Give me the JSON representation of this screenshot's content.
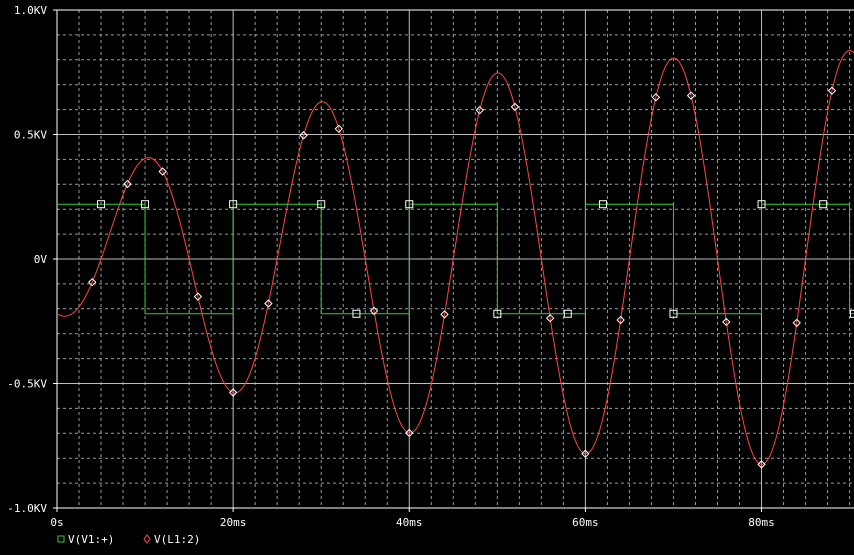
{
  "chart_data": {
    "type": "line",
    "x_unit": "s",
    "xlim": [
      0,
      0.0905
    ],
    "ylim": [
      -1000,
      1000
    ],
    "x_ticks": [
      0,
      0.02,
      0.04,
      0.06,
      0.08
    ],
    "x_tick_labels": [
      "0s",
      "20ms",
      "40ms",
      "60ms",
      "80ms"
    ],
    "y_ticks": [
      1000,
      500,
      0,
      -500,
      -1000
    ],
    "y_tick_labels": [
      "1.0KV",
      "0.5KV",
      "0V",
      "-0.5KV",
      "-1.0KV"
    ],
    "grid": true,
    "legend_position": "bottom-left",
    "series": [
      {
        "name": "V(V1:+)",
        "kind": "square",
        "color": "#33cc33",
        "marker": "square",
        "high": 220,
        "low": -220,
        "period": 0.02,
        "duty": 0.5,
        "marker_x": [
          0.005,
          0.01,
          0.02,
          0.03,
          0.034,
          0.04,
          0.05,
          0.058,
          0.062,
          0.07,
          0.08,
          0.087,
          0.0905
        ]
      },
      {
        "name": "V(L1:2)",
        "kind": "ringing-sine",
        "color": "#ff4444",
        "marker": "diamond",
        "omega": 314.159,
        "amplitude_start": 220,
        "amplitude_growth": 650,
        "growth_tau": 0.03,
        "offset_decay_tau": 0.02,
        "markers_every": 0.004,
        "peaks": [
          {
            "x": 0.0103,
            "y": 480
          },
          {
            "x": 0.0201,
            "y": -650
          },
          {
            "x": 0.0302,
            "y": 745
          },
          {
            "x": 0.0401,
            "y": -805
          },
          {
            "x": 0.0502,
            "y": 840
          },
          {
            "x": 0.0601,
            "y": -860
          },
          {
            "x": 0.0702,
            "y": 870
          },
          {
            "x": 0.0801,
            "y": -880
          },
          {
            "x": 0.0902,
            "y": 880
          }
        ]
      }
    ]
  }
}
